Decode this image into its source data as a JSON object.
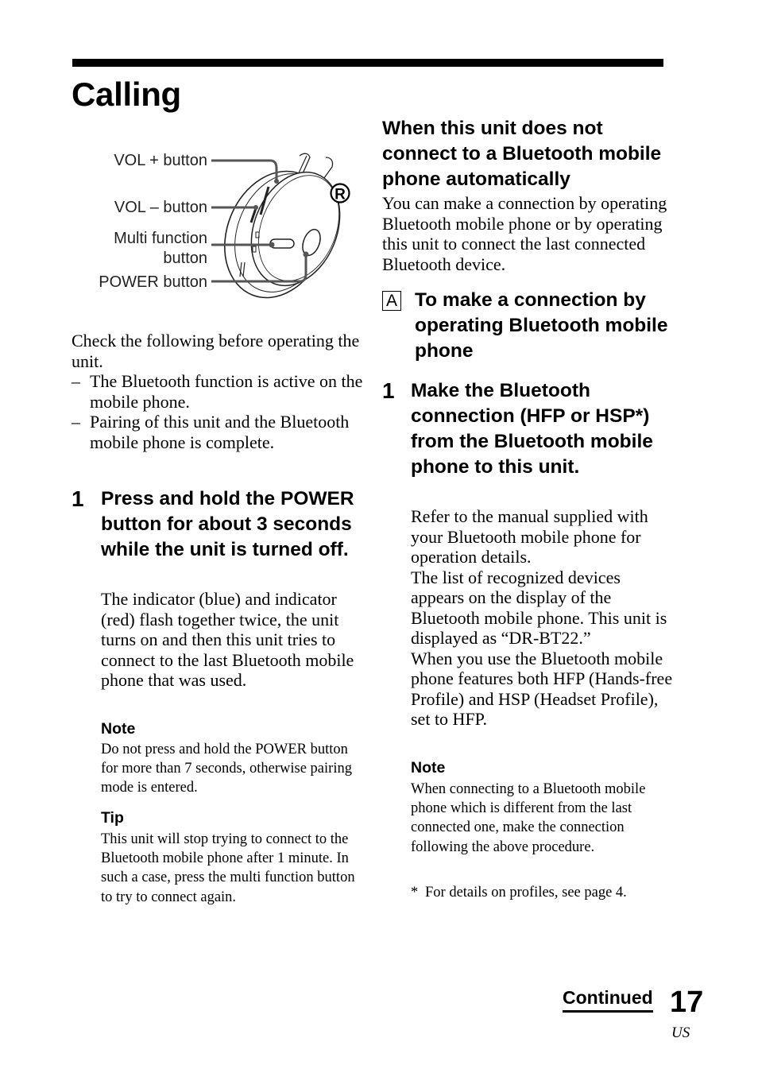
{
  "page": {
    "title": "Calling",
    "number": "17",
    "region": "US",
    "continued_label": "Continued"
  },
  "figure": {
    "icon": "headphone-right-earcup-diagram",
    "side_marker": "R",
    "labels": {
      "vol_plus": "VOL + button",
      "vol_minus": "VOL – button",
      "multi_function_line1": "Multi function",
      "multi_function_line2": "button",
      "power": "POWER button"
    }
  },
  "left_column": {
    "intro": "Check the following before operating the unit.",
    "checklist": [
      {
        "dash": "–",
        "text": "The Bluetooth function is active on the mobile phone."
      },
      {
        "dash": "–",
        "text": "Pairing of this unit and the Bluetooth mobile phone is complete."
      }
    ],
    "step1": {
      "number": "1",
      "heading": "Press and hold the POWER button for about 3 seconds while the unit is turned off.",
      "body": "The indicator (blue) and indicator (red) flash together twice, the unit turns on and then this unit tries to connect to the last Bluetooth mobile phone that was used."
    },
    "note": {
      "label": "Note",
      "text": "Do not press and hold the POWER button for more than 7 seconds, otherwise pairing mode is entered."
    },
    "tip": {
      "label": "Tip",
      "text": "This unit will stop trying to connect to the Bluetooth mobile phone after 1 minute. In such a case, press the multi function button to try to connect again."
    }
  },
  "right_column": {
    "heading": "When this unit does not connect to a Bluetooth mobile phone automatically",
    "body": "You can make a connection by operating Bluetooth mobile phone or by operating this unit to connect the last connected Bluetooth device.",
    "section_a": {
      "marker": "A",
      "heading": "To make a connection by operating Bluetooth mobile phone"
    },
    "step1": {
      "number": "1",
      "heading": "Make the Bluetooth connection (HFP or HSP*) from the Bluetooth mobile phone to this unit.",
      "body_lines": [
        "Refer to the manual supplied with your Bluetooth mobile phone for operation details.",
        "The list of recognized devices appears on the display of the Bluetooth mobile phone. This unit is displayed as “DR-BT22.”",
        "When you use the Bluetooth mobile phone features both HFP (Hands-free Profile) and HSP (Headset Profile), set to HFP."
      ]
    },
    "note": {
      "label": "Note",
      "text": "When connecting to a Bluetooth mobile phone which is different from the last connected one, make the connection following the above procedure."
    },
    "footnote": {
      "marker": "*",
      "text": "For details on profiles, see page 4."
    }
  }
}
